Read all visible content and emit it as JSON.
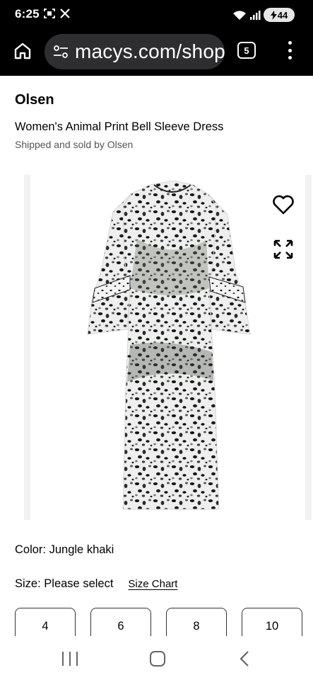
{
  "status_bar": {
    "time": "6:25",
    "icons": [
      "screenshot-icon",
      "x-logo-icon"
    ],
    "battery": "44"
  },
  "browser": {
    "url": "macys.com/shop",
    "tab_count": "5"
  },
  "product": {
    "brand": "Olsen",
    "title": "Women's Animal Print Bell Sleeve Dress",
    "seller": "Shipped and sold by Olsen",
    "image_alt": "animal print bell sleeve dress",
    "color_label": "Color:",
    "color_value": "Jungle khaki",
    "size_label": "Size:",
    "size_value": "Please select",
    "size_chart_label": "Size Chart",
    "sizes": [
      "4",
      "6",
      "8",
      "10"
    ]
  },
  "colors": {
    "browser_bg": "#000000",
    "url_pill": "#2e2e31",
    "text": "#000000",
    "muted_text": "#555555",
    "image_edge": "#f1f1f1"
  }
}
